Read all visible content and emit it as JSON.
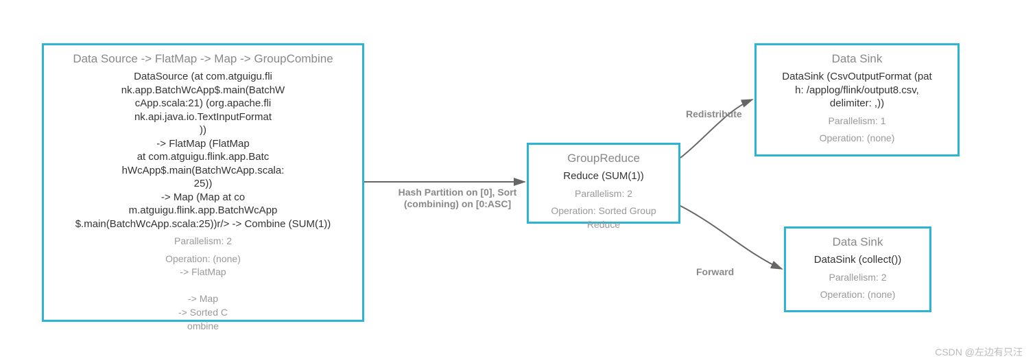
{
  "nodes": {
    "source": {
      "title": "Data Source -> FlatMap -> Map -> GroupCombine",
      "body": "DataSource (at com.atguigu.fli\nnk.app.BatchWcApp$.main(BatchW\ncApp.scala:21) (org.apache.fli\nnk.api.java.io.TextInputFormat\n))\n-> FlatMap (FlatMap\nat com.atguigu.flink.app.Batc\nhWcApp$.main(BatchWcApp.scala:\n25))\n-> Map (Map at co\nm.atguigu.flink.app.BatchWcApp\n$.main(BatchWcApp.scala:25))r/> -> Combine (SUM(1))",
      "parallelism": "Parallelism: 2",
      "operation": "Operation: (none)\n-> FlatMap\n\n-> Map\n-> Sorted C\nombine"
    },
    "reduce": {
      "title": "GroupReduce",
      "body": "Reduce (SUM(1))",
      "parallelism": "Parallelism: 2",
      "operation": "Operation: Sorted Group Reduce"
    },
    "sink1": {
      "title": "Data Sink",
      "body": "DataSink (CsvOutputFormat (pat\nh: /applog/flink/output8.csv,\ndelimiter: ,))",
      "parallelism": "Parallelism: 1",
      "operation": "Operation: (none)"
    },
    "sink2": {
      "title": "Data Sink",
      "body": "DataSink (collect())",
      "parallelism": "Parallelism: 2",
      "operation": "Operation: (none)"
    }
  },
  "edges": {
    "e1": "Hash Partition on [0],\nSort (combining) on [0:ASC]",
    "e2": "Redistribute",
    "e3": "Forward"
  },
  "watermark": "CSDN @左边有只汪"
}
